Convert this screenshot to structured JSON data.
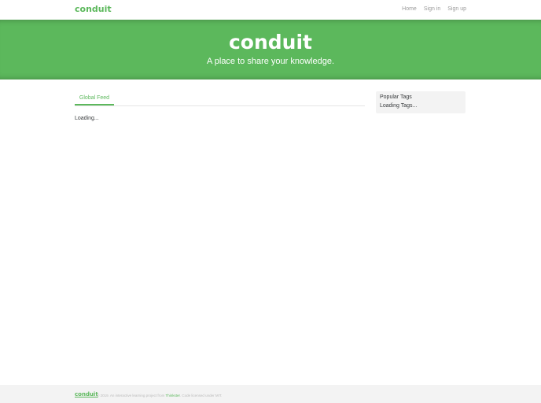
{
  "navbar": {
    "brand": "conduit",
    "links": [
      "Home",
      "Sign in",
      "Sign up"
    ]
  },
  "banner": {
    "title": "conduit",
    "subtitle": "A place to share your knowledge."
  },
  "feed": {
    "tab_label": "Global Feed",
    "loading_text": "Loading..."
  },
  "sidebar": {
    "title": "Popular Tags",
    "loading_text": "Loading Tags..."
  },
  "footer": {
    "brand": "conduit",
    "attribution_prefix": "© 2019. An interactive learning project from",
    "attribution_link": "Thinkster",
    "attribution_suffix": ". Code licensed under MIT."
  },
  "colors": {
    "accent": "#5cb85c",
    "sidebar_bg": "#f3f3f3",
    "footer_bg": "#f3f3f3"
  }
}
